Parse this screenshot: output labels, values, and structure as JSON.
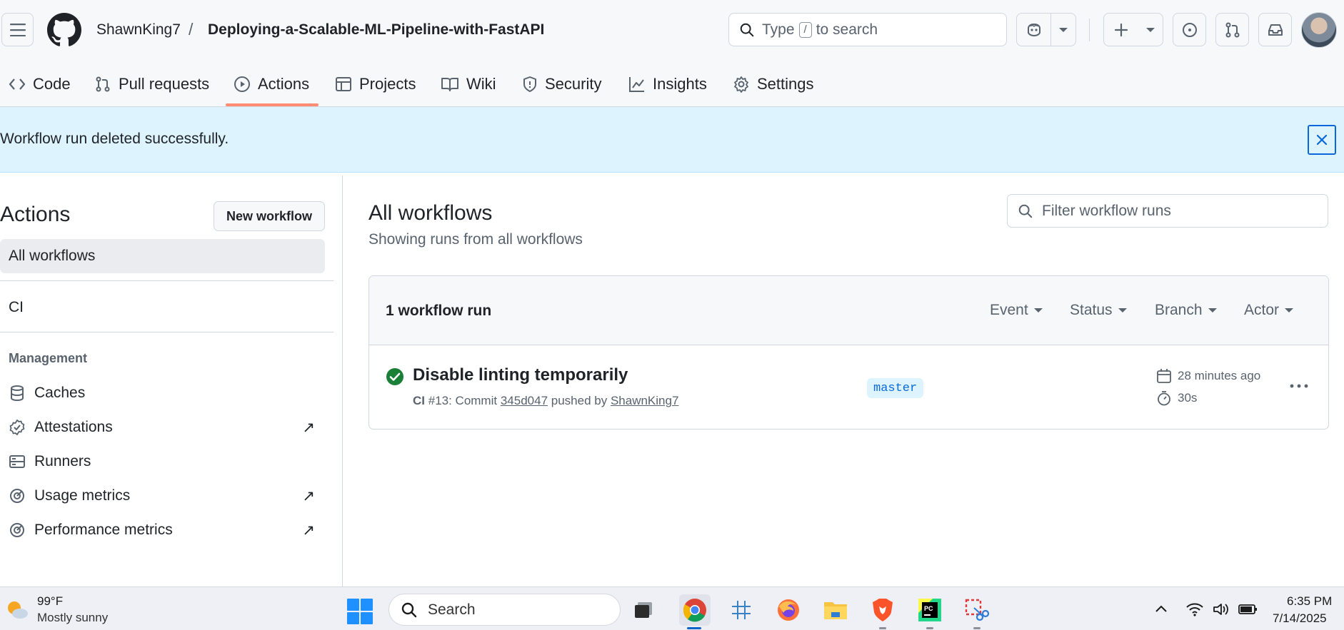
{
  "repo": {
    "owner": "ShawnKing7",
    "separator": "/",
    "name": "Deploying-a-Scalable-ML-Pipeline-with-FastAPI"
  },
  "search": {
    "prefix": "Type",
    "key": "/",
    "suffix": "to search"
  },
  "tabs": [
    {
      "label": "Code",
      "icon": "code-icon"
    },
    {
      "label": "Pull requests",
      "icon": "pull-request-icon"
    },
    {
      "label": "Actions",
      "icon": "play-icon",
      "active": true
    },
    {
      "label": "Projects",
      "icon": "table-icon"
    },
    {
      "label": "Wiki",
      "icon": "book-icon"
    },
    {
      "label": "Security",
      "icon": "shield-icon"
    },
    {
      "label": "Insights",
      "icon": "graph-icon"
    },
    {
      "label": "Settings",
      "icon": "gear-icon"
    }
  ],
  "flash": {
    "message": "Workflow run deleted successfully."
  },
  "sidebar": {
    "title": "Actions",
    "new_workflow": "New workflow",
    "items": [
      {
        "label": "All workflows",
        "selected": true
      },
      {
        "label": "CI"
      }
    ],
    "management_heading": "Management",
    "management": [
      {
        "label": "Caches",
        "icon": "database-icon"
      },
      {
        "label": "Attestations",
        "icon": "verified-icon",
        "external": "↗"
      },
      {
        "label": "Runners",
        "icon": "server-icon"
      },
      {
        "label": "Usage metrics",
        "icon": "meter-icon",
        "external": "↗"
      },
      {
        "label": "Performance metrics",
        "icon": "meter-icon",
        "external": "↗"
      }
    ]
  },
  "main": {
    "title": "All workflows",
    "subtitle": "Showing runs from all workflows",
    "filter_placeholder": "Filter workflow runs",
    "runs_count": "1 workflow run",
    "filters": [
      "Event",
      "Status",
      "Branch",
      "Actor"
    ],
    "run": {
      "status": "success",
      "title": "Disable linting temporarily",
      "workflow": "CI",
      "number": "#13: Commit",
      "commit": "345d047",
      "pushed_by": "pushed by",
      "actor": "ShawnKing7",
      "branch": "master",
      "time_ago": "28 minutes ago",
      "duration": "30s"
    }
  },
  "taskbar": {
    "weather_temp": "99°F",
    "weather_desc": "Mostly sunny",
    "search_label": "Search",
    "apps": [
      "task-view",
      "chrome",
      "snipping-grid",
      "firefox",
      "file-explorer",
      "brave",
      "pycharm",
      "snipping-tool"
    ],
    "time": "6:35 PM",
    "date": "7/14/2025"
  },
  "colors": {
    "accent_underline": "#fd8c73",
    "flash_bg": "#ddf4ff",
    "success": "#1a7f37",
    "link": "#0969da"
  }
}
